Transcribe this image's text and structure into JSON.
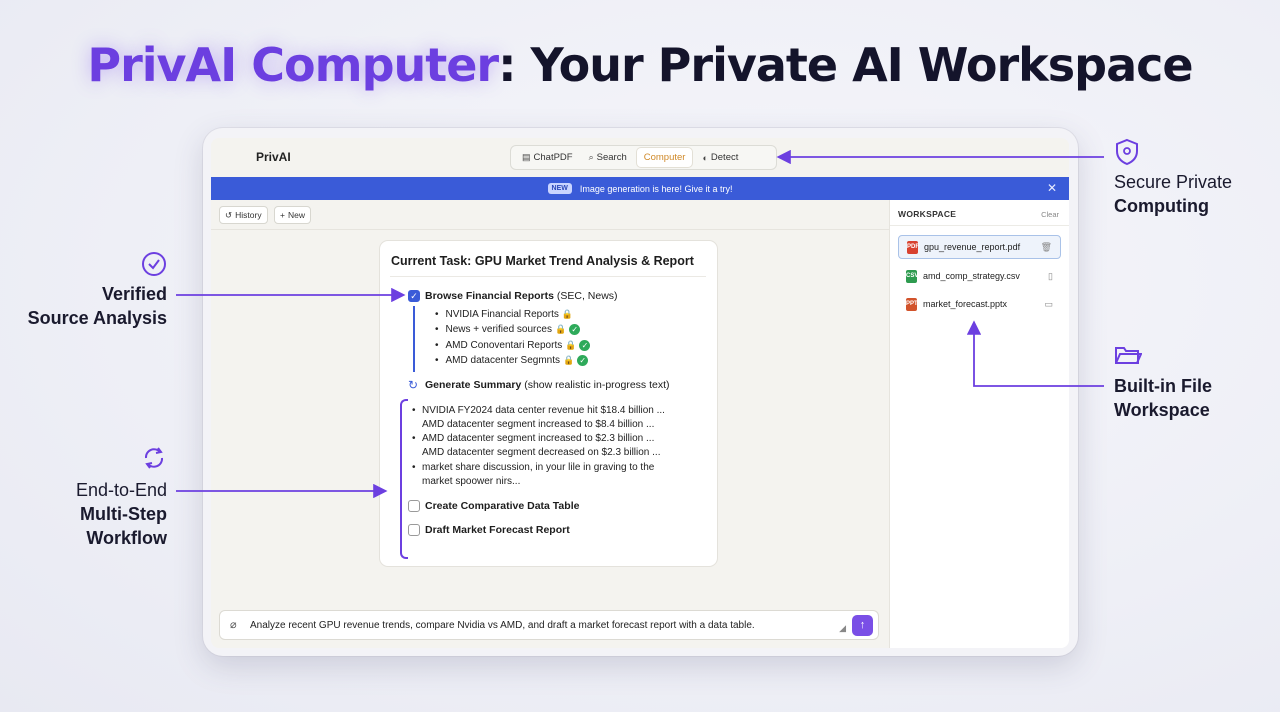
{
  "headline": {
    "brand": "PrivAI Computer",
    "rest": ": Your Private AI Workspace"
  },
  "app": {
    "name": "PrivAI",
    "nav": [
      {
        "label": "ChatPDF",
        "icon": "document-icon"
      },
      {
        "label": "Search",
        "icon": "search-icon"
      },
      {
        "label": "Computer",
        "icon": ""
      },
      {
        "label": "Detect",
        "icon": "shield-icon"
      }
    ],
    "active_nav": "Computer",
    "banner": {
      "badge": "NEW",
      "text": "Image generation is here! Give it a try!",
      "close": "✕"
    },
    "history_label": "History",
    "new_label": "New"
  },
  "task": {
    "title": "Current Task: GPU Market Trend Analysis & Report",
    "step1": {
      "bold": "Browse Financial Reports",
      "rest": " (SEC, News)"
    },
    "sources": [
      "NVIDIA Financial Reports",
      "News + verified sources",
      "AMD Conoventari Reports",
      "AMD datacenter Segmnts"
    ],
    "step2": {
      "bold": "Generate Summary",
      "rest": " (show realistic in-progress text)"
    },
    "summary_lines": [
      "NVIDIA FY2024 data center revenue hit $18.4 billion ...",
      "AMD datacenter segment increased to $8.4 billion ...",
      "AMD datacenter segment increased to $2.3 billion ...",
      "AMD datacenter segment decreased on $2.3 billion ...",
      "market share discussion, in your lile in graving to the",
      "market spoower nirs..."
    ],
    "step3": "Create Comparative Data Table",
    "step4": "Draft Market Forecast Report"
  },
  "input": {
    "value": "Analyze recent GPU revenue trends, compare Nvidia vs AMD, and draft a market forecast report with a data table."
  },
  "workspace": {
    "title": "WORKSPACE",
    "clear": "Clear",
    "files": [
      {
        "name": "gpu_revenue_report.pdf",
        "type": "PDF",
        "color": "#d8412f",
        "action": "trash-icon"
      },
      {
        "name": "amd_comp_strategy.csv",
        "type": "CSV",
        "color": "#2e9b4f",
        "action": "pin-icon"
      },
      {
        "name": "market_forecast.pptx",
        "type": "PPT",
        "color": "#d2532b",
        "action": "folder-icon"
      }
    ]
  },
  "callouts": {
    "secure": [
      "Secure Private",
      "Computing"
    ],
    "verified": [
      "Verified",
      "Source Analysis"
    ],
    "workflow": [
      "End-to-End",
      "Multi-Step",
      "Workflow"
    ],
    "files": [
      "Built-in File",
      "Workspace"
    ]
  },
  "colors": {
    "accent": "#6c3fe0",
    "banner": "#3a5bd8",
    "active_nav": "#d08a2a",
    "check": "#2eaa5a"
  }
}
